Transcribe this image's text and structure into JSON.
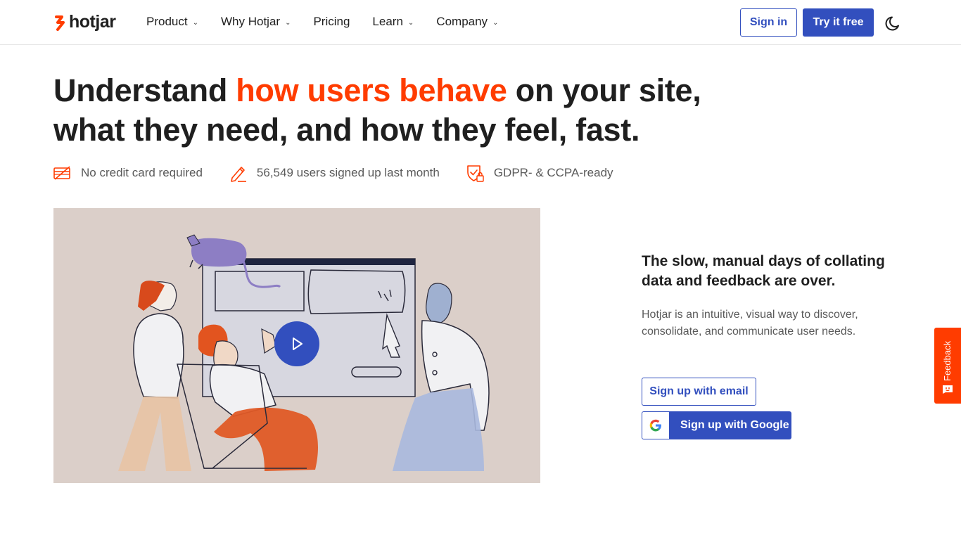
{
  "header": {
    "logo_text": "hotjar",
    "nav": [
      {
        "label": "Product",
        "has_dropdown": true
      },
      {
        "label": "Why Hotjar",
        "has_dropdown": true
      },
      {
        "label": "Pricing",
        "has_dropdown": false
      },
      {
        "label": "Learn",
        "has_dropdown": true
      },
      {
        "label": "Company",
        "has_dropdown": true
      }
    ],
    "sign_in_label": "Sign in",
    "try_free_label": "Try it free",
    "theme_icon": "moon-icon"
  },
  "hero": {
    "title_part1": "Understand ",
    "title_accent": "how users behave",
    "title_part2": " on your site, what they need, and how they feel, fast.",
    "badges": [
      {
        "icon": "credit-card-crossed-icon",
        "text": "No credit card required"
      },
      {
        "icon": "pencil-icon",
        "text": "56,549 users signed up last month"
      },
      {
        "icon": "shield-lock-icon",
        "text": "GDPR- & CCPA-ready"
      }
    ]
  },
  "video": {
    "play_icon": "play-icon"
  },
  "side": {
    "title": "The slow, manual days of collating data and feedback are over.",
    "description": "Hotjar is an intuitive, visual way to discover, consolidate, and communicate user needs.",
    "email_button_label": "Sign up with email",
    "google_button_label": "Sign up with Google"
  },
  "feedback_tab": {
    "label": "Feedback"
  },
  "colors": {
    "accent": "#ff3c00",
    "primary": "#324fbe",
    "text": "#1f1f1f",
    "muted": "#5a5a5a"
  }
}
